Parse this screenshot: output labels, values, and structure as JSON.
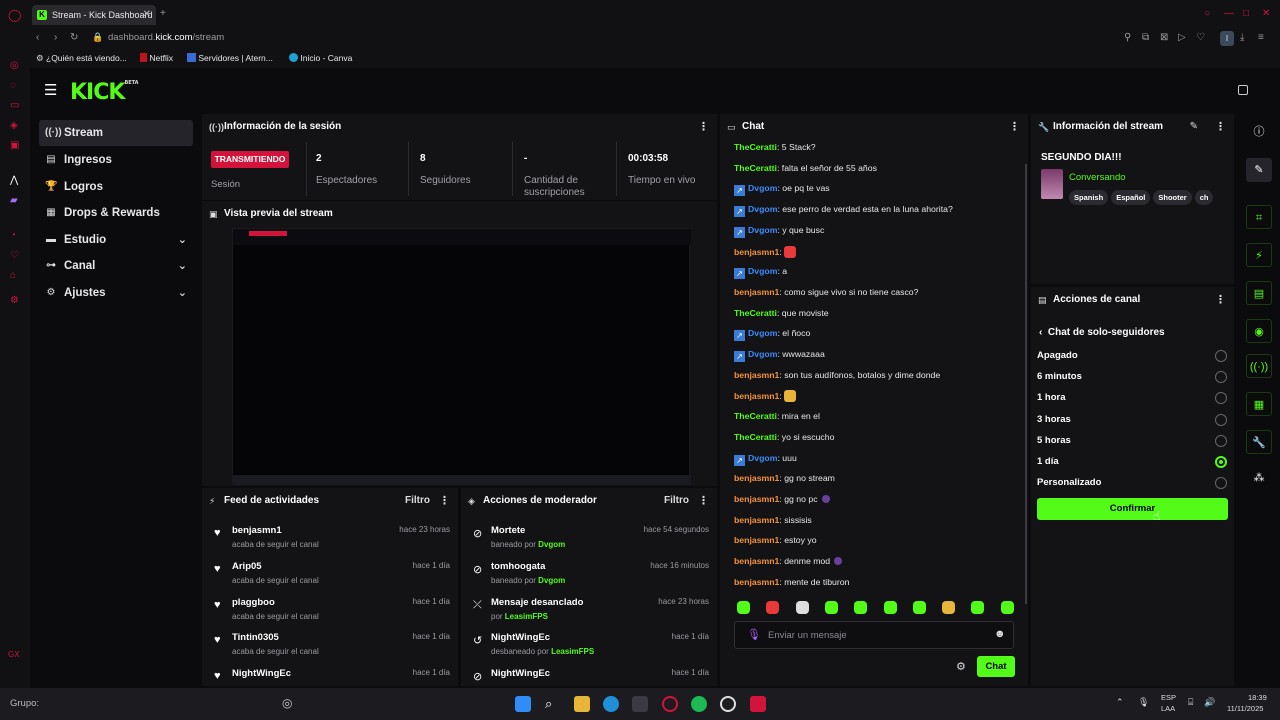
{
  "browser": {
    "tab_title": "Stream - Kick Dashboard",
    "url_prefix": "dashboard.",
    "url_domain": "kick.com",
    "url_path": "/stream",
    "bookmarks": [
      "¿Quién está viendo...",
      "Netflix",
      "Servidores | Atern...",
      "Inicio - Canva"
    ]
  },
  "app": {
    "logo": "KICK",
    "logo_beta": "BETA"
  },
  "nav": [
    {
      "label": "Stream",
      "icon": "broadcast-icon"
    },
    {
      "label": "Ingresos",
      "icon": "dollar-icon"
    },
    {
      "label": "Logros",
      "icon": "trophy-icon"
    },
    {
      "label": "Drops & Rewards",
      "icon": "gift-icon"
    },
    {
      "label": "Estudio",
      "icon": "studio-icon"
    },
    {
      "label": "Canal",
      "icon": "channel-icon"
    },
    {
      "label": "Ajustes",
      "icon": "gear-icon"
    }
  ],
  "session": {
    "title": "Información de la sesión",
    "live_badge": "TRANSMITIENDO",
    "session_label": "Sesión",
    "stats": [
      {
        "value": "2",
        "label": "Espectadores"
      },
      {
        "value": "8",
        "label": "Seguidores"
      },
      {
        "value": "-",
        "label": "Cantidad de suscripciones"
      },
      {
        "value": "00:03:58",
        "label": "Tiempo en vivo"
      }
    ]
  },
  "preview": {
    "title": "Vista previa del stream"
  },
  "feed": {
    "title": "Feed de actividades",
    "filter": "Filtro",
    "items": [
      {
        "name": "benjasmn1",
        "sub": "acaba de seguir el canal",
        "time": "hace 23 horas"
      },
      {
        "name": "Arip05",
        "sub": "acaba de seguir el canal",
        "time": "hace 1 día"
      },
      {
        "name": "plaggboo",
        "sub": "acaba de seguir el canal",
        "time": "hace 1 día"
      },
      {
        "name": "Tintin0305",
        "sub": "acaba de seguir el canal",
        "time": "hace 1 día"
      },
      {
        "name": "NightWingEc",
        "sub": "",
        "time": "hace 1 día"
      }
    ]
  },
  "mod": {
    "title": "Acciones de moderador",
    "filter": "Filtro",
    "items": [
      {
        "name": "Mortete",
        "sub": "baneado por",
        "by": "Dvgom",
        "time": "hace 54 segundos"
      },
      {
        "name": "tomhoogata",
        "sub": "baneado por",
        "by": "Dvgom",
        "time": "hace 16 minutos"
      },
      {
        "name": "Mensaje desanclado",
        "sub": "por",
        "by": "LeasimFPS",
        "time": "hace 23 horas"
      },
      {
        "name": "NightWingEc",
        "sub": "desbaneado por",
        "by": "LeasimFPS",
        "time": "hace 1 día"
      },
      {
        "name": "NightWingEc",
        "sub": "",
        "by": "",
        "time": "hace 1 día"
      }
    ]
  },
  "chat": {
    "title": "Chat",
    "placeholder": "Enviar un mensaje",
    "send": "Chat",
    "messages": [
      {
        "user": "TheCeratti",
        "color": "#53fc18",
        "text": "5 Stack?",
        "badge": false
      },
      {
        "user": "TheCeratti",
        "color": "#53fc18",
        "text": "falta el señor de 55 años",
        "badge": false
      },
      {
        "user": "Dvgom",
        "color": "#3d8bfd",
        "text": "oe pq te vas",
        "badge": true
      },
      {
        "user": "Dvgom",
        "color": "#3d8bfd",
        "text": "ese perro de verdad esta en la luna ahorita?",
        "badge": true
      },
      {
        "user": "Dvgom",
        "color": "#3d8bfd",
        "text": "y que busc",
        "badge": true
      },
      {
        "user": "benjasmn1",
        "color": "#f5923e",
        "text": "",
        "badge": false,
        "emote": "#e83a3a"
      },
      {
        "user": "Dvgom",
        "color": "#3d8bfd",
        "text": "a",
        "badge": true
      },
      {
        "user": "benjasmn1",
        "color": "#f5923e",
        "text": "como sigue vivo si no tiene casco?",
        "badge": false
      },
      {
        "user": "TheCeratti",
        "color": "#53fc18",
        "text": "que moviste",
        "badge": false
      },
      {
        "user": "Dvgom",
        "color": "#3d8bfd",
        "text": "el ñoco",
        "badge": true
      },
      {
        "user": "Dvgom",
        "color": "#3d8bfd",
        "text": "wwwazaaa",
        "badge": true
      },
      {
        "user": "benjasmn1",
        "color": "#f5923e",
        "text": "son tus audífonos, botalos y dime donde",
        "badge": false
      },
      {
        "user": "benjasmn1",
        "color": "#f5923e",
        "text": "",
        "badge": false,
        "emote": "#e8b43a"
      },
      {
        "user": "TheCeratti",
        "color": "#53fc18",
        "text": "mira en el",
        "badge": false
      },
      {
        "user": "TheCeratti",
        "color": "#53fc18",
        "text": "yo si escucho",
        "badge": false
      },
      {
        "user": "Dvgom",
        "color": "#3d8bfd",
        "text": "uuu",
        "badge": true
      },
      {
        "user": "benjasmn1",
        "color": "#f5923e",
        "text": "gg no stream",
        "badge": false
      },
      {
        "user": "benjasmn1",
        "color": "#f5923e",
        "text": "gg no pc",
        "badge": false,
        "emote2": "#6a3fa0"
      },
      {
        "user": "benjasmn1",
        "color": "#f5923e",
        "text": "sissisis",
        "badge": false
      },
      {
        "user": "benjasmn1",
        "color": "#f5923e",
        "text": "estoy yo",
        "badge": false
      },
      {
        "user": "benjasmn1",
        "color": "#f5923e",
        "text": "denme mod",
        "badge": false,
        "emote2": "#6a3fa0"
      },
      {
        "user": "benjasmn1",
        "color": "#f5923e",
        "text": "mente de tiburon",
        "badge": false
      }
    ]
  },
  "streaminfo": {
    "title": "Información del stream",
    "stream_title": "SEGUNDO DIA!!!",
    "category": "Conversando",
    "tags": [
      "Spanish",
      "Español",
      "Shooter",
      "ch"
    ]
  },
  "actions": {
    "title": "Acciones de canal",
    "back_label": "Chat de solo-seguidores",
    "options": [
      {
        "label": "Apagado",
        "selected": false
      },
      {
        "label": "6 minutos",
        "selected": false
      },
      {
        "label": "1 hora",
        "selected": false
      },
      {
        "label": "3 horas",
        "selected": false
      },
      {
        "label": "5 horas",
        "selected": false
      },
      {
        "label": "1 día",
        "selected": true
      },
      {
        "label": "Personalizado",
        "selected": false
      }
    ],
    "confirm": "Confirmar"
  },
  "taskbar": {
    "group_label": "Grupo:",
    "lang": "ESP",
    "lang2": "LAA",
    "time": "18:39",
    "date": "11/11/2025"
  },
  "colors": {
    "accent": "#53fc18",
    "live": "#d2133c"
  }
}
